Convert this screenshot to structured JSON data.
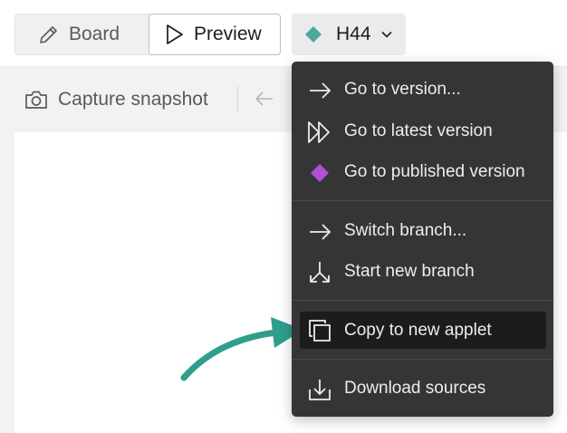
{
  "header": {
    "board_label": "Board",
    "preview_label": "Preview",
    "version_label": "H44",
    "version_color": "#4aa99c"
  },
  "toolbar": {
    "capture_label": "Capture snapshot"
  },
  "menu": {
    "items": [
      {
        "label": "Go to version...",
        "icon": "arrow-right-icon"
      },
      {
        "label": "Go to latest version",
        "icon": "fast-forward-icon"
      },
      {
        "label": "Go to published version",
        "icon": "diamond-icon",
        "icon_color": "#b24fd6"
      },
      {
        "label": "Switch branch...",
        "icon": "arrow-right-icon"
      },
      {
        "label": "Start new branch",
        "icon": "branch-icon"
      },
      {
        "label": "Copy to new applet",
        "icon": "copy-icon",
        "active": true
      },
      {
        "label": "Download sources",
        "icon": "download-icon"
      }
    ]
  },
  "annotation": {
    "arrow_color": "#2f9e8c"
  }
}
